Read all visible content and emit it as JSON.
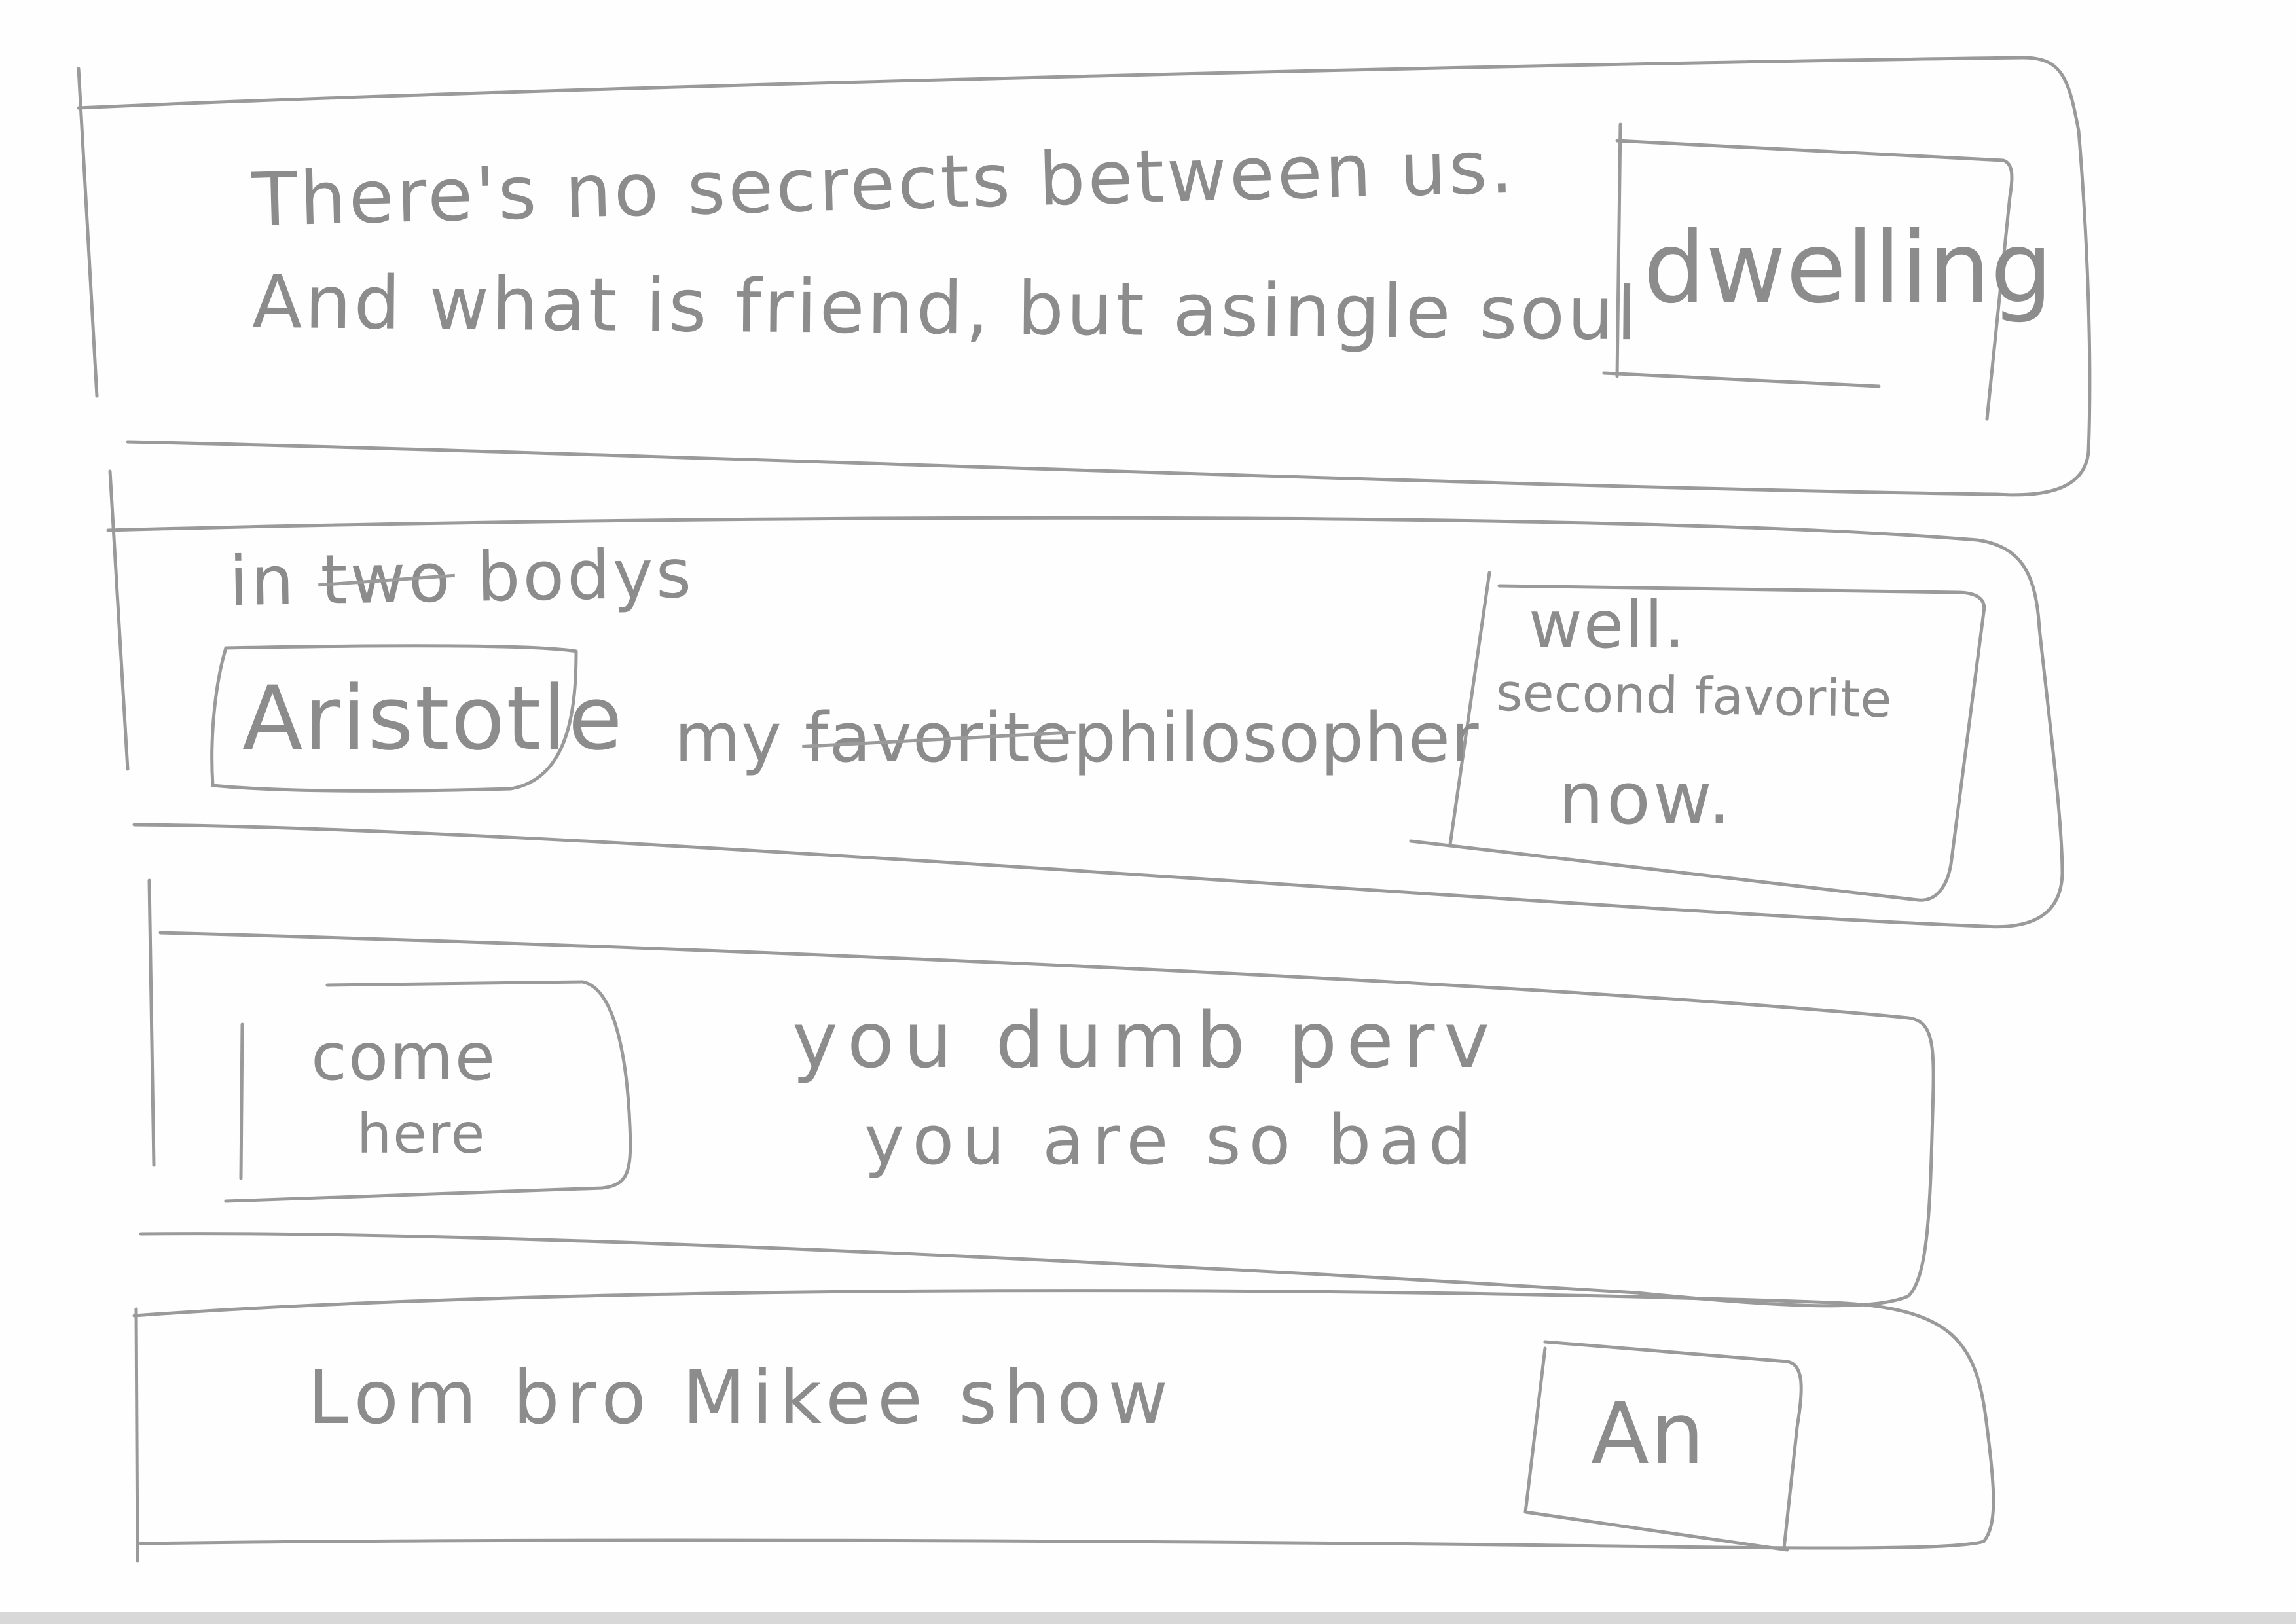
{
  "panel_1": {
    "line_1": "There's no secrects between us.",
    "line_2": "And what is friend, but asingle soul",
    "box_label": "dwelling"
  },
  "panel_2": {
    "line_1_prefix": "in",
    "line_1_struck": "two",
    "line_1_suffix": "bodys",
    "name_box_label": "Aristotle",
    "line_2_prefix": "my",
    "line_2_struck": "favorite",
    "line_2_suffix": "philosopher",
    "note_line_1": "well.",
    "note_line_2": "second favorite",
    "note_line_3": "now."
  },
  "panel_3": {
    "box_line_1": "come",
    "box_line_2": "here",
    "line_1": "you dumb perv",
    "line_2": "you are so bad"
  },
  "panel_4": {
    "line_1": "Lom bro Mikee show",
    "box_label": "An"
  }
}
